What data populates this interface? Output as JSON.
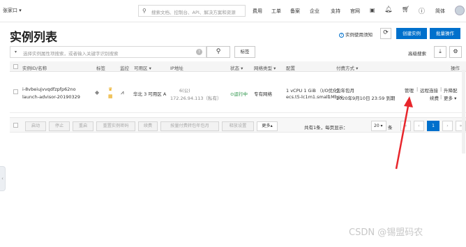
{
  "topbar": {
    "region": "张家口",
    "region_arrow": "▾",
    "search_placeholder": "搜索文档、控制台、API、解决方案和资源",
    "nav": [
      "费用",
      "工单",
      "备案",
      "企业",
      "支持",
      "官网"
    ],
    "language": "简体"
  },
  "page": {
    "title": "实例列表",
    "guide_label": "实例使用须知",
    "refresh_icon": "refresh-icon",
    "create_button": "创建实例",
    "batch_button": "批量操作"
  },
  "filter": {
    "placeholder": "选择实例属性项搜索，或者输入关键字识别搜索",
    "tag_button": "标签",
    "advanced_search": "高级搜索"
  },
  "table": {
    "headers": {
      "id_name": "实例ID/名称",
      "tags": "标签",
      "monitor": "监控",
      "zone": "可用区",
      "ip": "IP地址",
      "status": "状态",
      "network_type": "网络类型",
      "config": "配置",
      "payment": "付费方式",
      "actions": "操作"
    },
    "row": {
      "id": "i-8vbeiujvvqdfzpfp62no",
      "name": "launch-advisor-20190329",
      "zone": "华北 3 可用区 A",
      "ip_public": "6(公)",
      "ip_private": "172.26.94.113（私有）",
      "status": "运行中",
      "network": "专有网络",
      "config_line1": "1 vCPU 1 GiB （I/O优化）",
      "config_line2_type": "ecs.t5-lc1m1.small",
      "config_line2_bw": "1Mbps",
      "payment_line1": "包年包月",
      "payment_line2": "2020年9月10日 23:59 到期",
      "action_manage": "管理",
      "action_remote": "远程连接",
      "action_upgrade": "升降配",
      "action_renew": "续费",
      "action_more": "更多"
    }
  },
  "footer": {
    "buttons": [
      "启动",
      "停止",
      "重启",
      "重置实例密码",
      "续费",
      "按量付费转包年包月",
      "释放设置"
    ],
    "more": "更多▴",
    "summary": "共有1条，每页显示：",
    "page_size": "20",
    "unit": "条",
    "pages": [
      "«",
      "‹",
      "1",
      "›",
      "»"
    ]
  },
  "watermark": "CSDN @锡盟码农",
  "colors": {
    "primary": "#0070cc",
    "status_green": "#1e8e3e",
    "annotation_red": "#e8262c"
  }
}
